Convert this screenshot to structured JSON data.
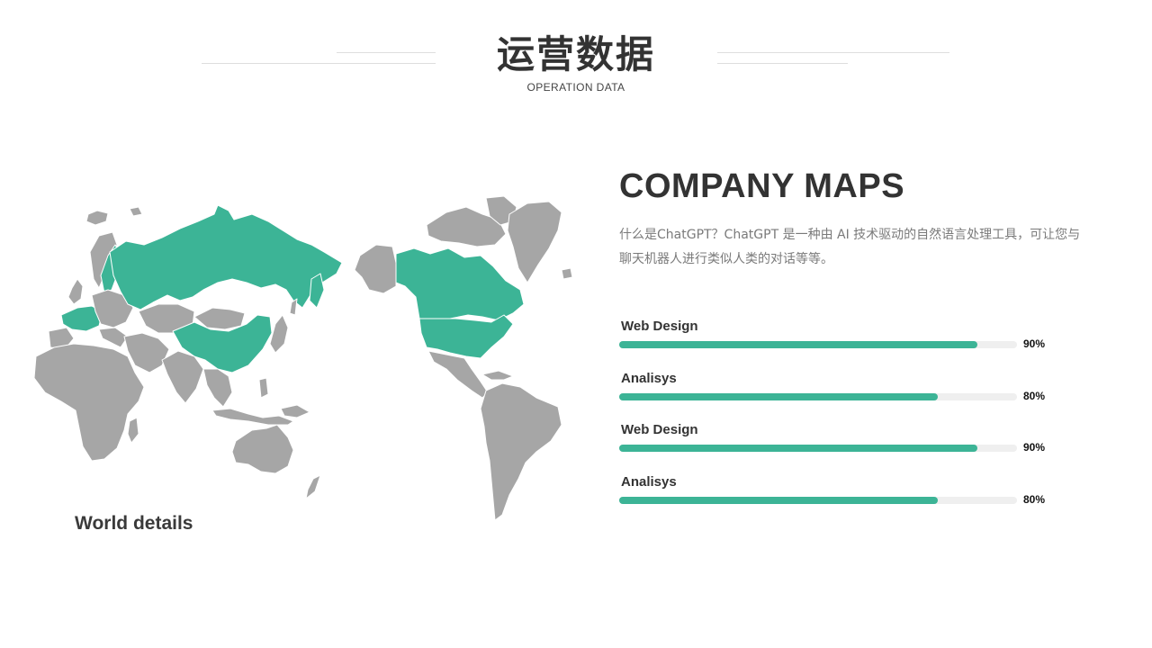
{
  "header": {
    "title": "运营数据",
    "subtitle": "OPERATION DATA"
  },
  "map": {
    "caption": "World details",
    "land_color": "#a6a6a6",
    "highlight_color": "#3cb496",
    "highlighted_regions": [
      "Russia",
      "China",
      "Canada",
      "United States",
      "Greenland",
      "Western Europe"
    ]
  },
  "content": {
    "heading": "COMPANY MAPS",
    "description": "什么是ChatGPT？ChatGPT 是一种由 AI 技术驱动的自然语言处理工具，可让您与聊天机器人进行类似人类的对话等等。"
  },
  "progress": [
    {
      "label": "Web Design",
      "value_text": "90%",
      "fraction": 0.9
    },
    {
      "label": "Analisys",
      "value_text": "80%",
      "fraction": 0.8
    },
    {
      "label": "Web Design",
      "value_text": "90%",
      "fraction": 0.9
    },
    {
      "label": "Analisys",
      "value_text": "80%",
      "fraction": 0.8
    }
  ],
  "colors": {
    "accent": "#3cb496",
    "track": "#efefef",
    "text_dark": "#333333",
    "text_muted": "#7a7a7a"
  }
}
